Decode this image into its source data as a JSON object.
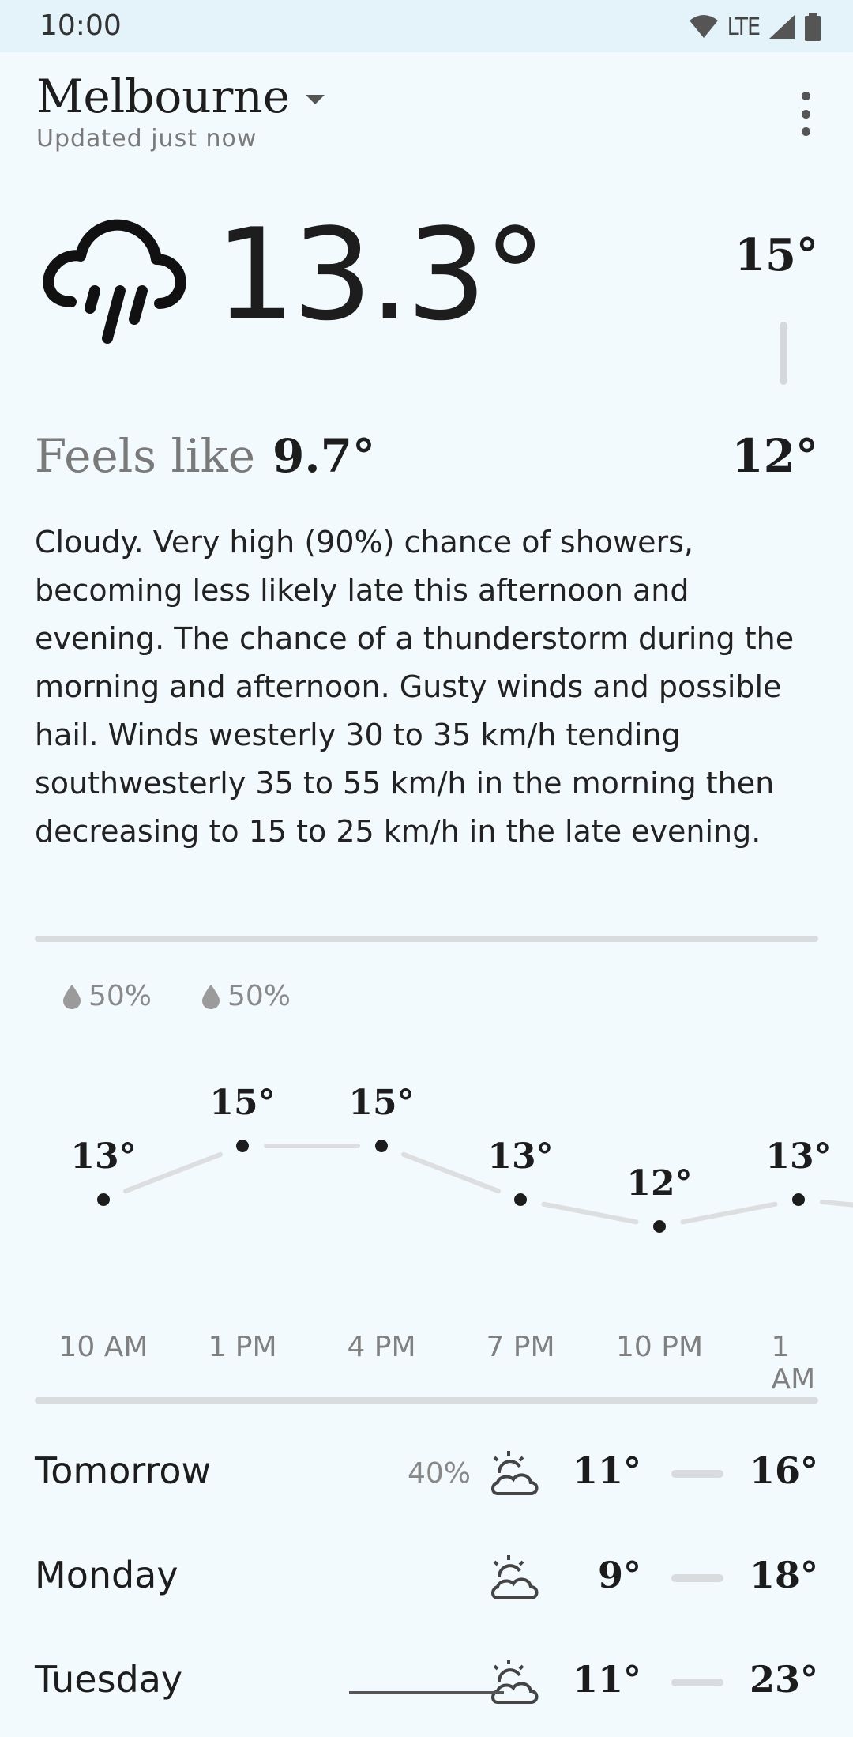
{
  "status_bar": {
    "time": "10:00",
    "network": "LTE"
  },
  "header": {
    "city": "Melbourne",
    "updated": "Updated just now"
  },
  "current": {
    "temperature": "13.3°",
    "high": "15°",
    "low": "12°",
    "feels_like_label": "Feels like",
    "feels_like_value": "9.7°",
    "icon": "rain-cloud-icon"
  },
  "summary": "Cloudy. Very high (90%) chance of showers, becoming less likely late this afternoon and evening. The chance of a thunderstorm during the morning and afternoon. Gusty winds and possible hail. Winds westerly 30 to 35 km/h tending southwesterly 35 to 55 km/h in the morning then decreasing to 15 to 25 km/h in the late evening.",
  "hourly": {
    "precip": [
      "50%",
      "50%"
    ],
    "times": [
      "10 AM",
      "1 PM",
      "4 PM",
      "7 PM",
      "10 PM",
      "1 AM"
    ],
    "temps": [
      "13°",
      "15°",
      "15°",
      "13°",
      "12°",
      "13°"
    ]
  },
  "chart_data": {
    "type": "line",
    "x": [
      "10 AM",
      "1 PM",
      "4 PM",
      "7 PM",
      "10 PM",
      "1 AM"
    ],
    "series": [
      {
        "values": [
          13,
          15,
          15,
          13,
          12,
          13
        ]
      }
    ],
    "precipitation_chance": {
      "10 AM": "50%",
      "1 PM": "50%"
    }
  },
  "daily": [
    {
      "day": "Tomorrow",
      "chance": "40%",
      "min": "11°",
      "max": "16°",
      "icon": "partly-cloudy-icon"
    },
    {
      "day": "Monday",
      "chance": "",
      "min": "9°",
      "max": "18°",
      "icon": "partly-cloudy-icon"
    },
    {
      "day": "Tuesday",
      "chance": "",
      "min": "11°",
      "max": "23°",
      "icon": "partly-cloudy-icon"
    }
  ]
}
